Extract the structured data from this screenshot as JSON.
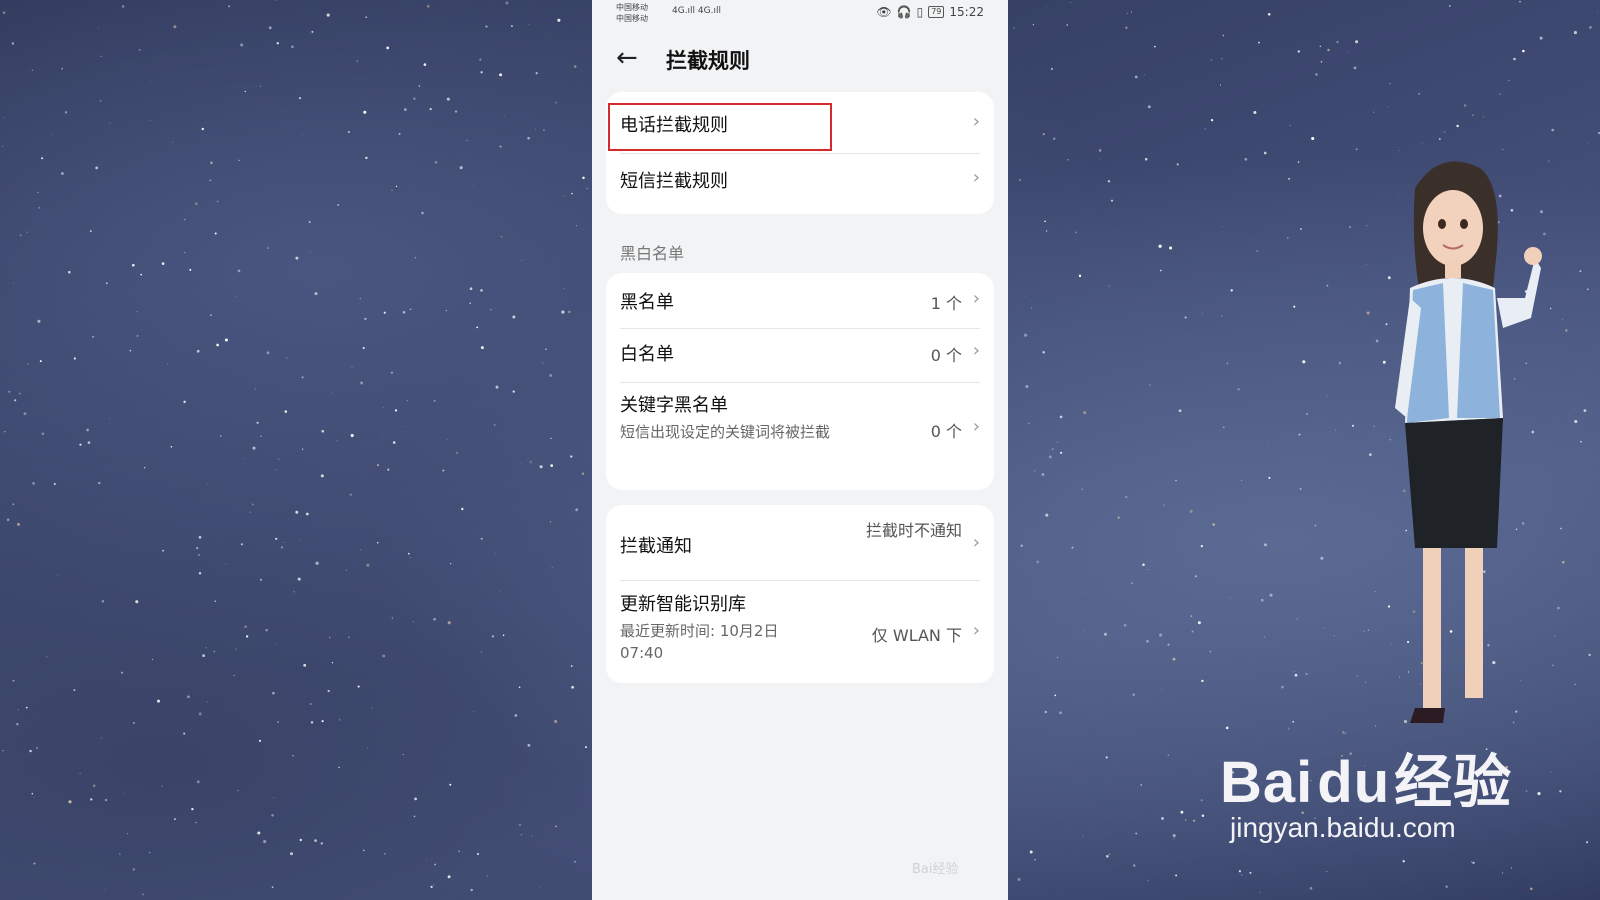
{
  "status": {
    "carrier1": "中国移动",
    "carrier2": "中国移动",
    "signal": "4G.ıll 4G.ıll",
    "battery": "79",
    "time": "15:22"
  },
  "header": {
    "back_icon": "arrow-left-icon",
    "title": "拦截规则"
  },
  "rules": [
    {
      "label": "电话拦截规则"
    },
    {
      "label": "短信拦截规则"
    }
  ],
  "section_label": "黑白名单",
  "lists": [
    {
      "label": "黑名单",
      "value": "1 个"
    },
    {
      "label": "白名单",
      "value": "0 个"
    },
    {
      "label": "关键字黑名单",
      "subtitle": "短信出现设定的关键词将被拦截",
      "value": "0 个"
    }
  ],
  "settings": [
    {
      "label": "拦截通知",
      "value": "拦截时不通知"
    },
    {
      "label": "更新智能识别库",
      "subtitle": "最近更新时间: 10月2日 07:40",
      "value": "仅 WLAN 下"
    }
  ],
  "watermark": {
    "small": "Bai经验",
    "logo_left": "Bai",
    "logo_paw": "du",
    "logo_right": "经验",
    "url": "jingyan.baidu.com"
  },
  "colors": {
    "highlight": "#d42a2a",
    "panel": "#f1f3f5"
  }
}
